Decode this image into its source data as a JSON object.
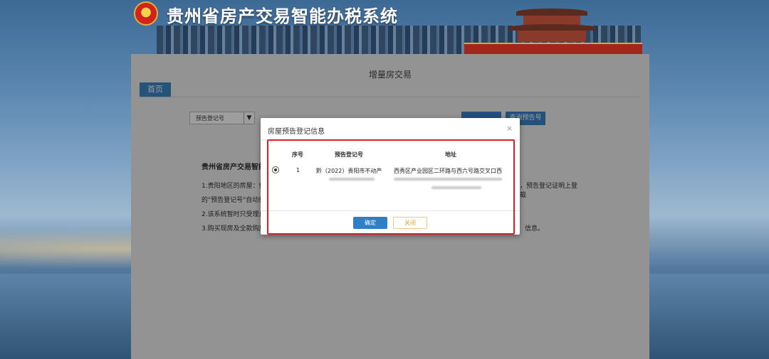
{
  "header": {
    "title": "贵州省房产交易智能办税系统"
  },
  "page": {
    "panel_title": "增量房交易",
    "tab_home": "首页"
  },
  "search": {
    "field_type": "预告登记号",
    "search_reg_button": "查询预告号"
  },
  "notice": {
    "title": "贵州省房产交易智能",
    "lines": [
      "1.贵阳地区的房屋：依",
      "的\"预告登记号\"自动获",
      "2.该系统暂时只受理自",
      "3.购买现房及全款购房"
    ],
    "line1_right": "，预告登记证明上登载",
    "line4_right": "信息。"
  },
  "dialog": {
    "title": "房屋预告登记信息",
    "columns": [
      "序号",
      "预告登记号",
      "地址"
    ],
    "rows": [
      {
        "selected": true,
        "index": "1",
        "reg_no": "黔（2022）贵阳市不动产",
        "address": "西秀区产业园区二环路与西六号路交叉口西"
      }
    ],
    "ok_button": "确定",
    "close_button": "关闭"
  },
  "colors": {
    "primary": "#2f7fc6",
    "highlight": "#e02020",
    "title_red": "#a3261d"
  }
}
